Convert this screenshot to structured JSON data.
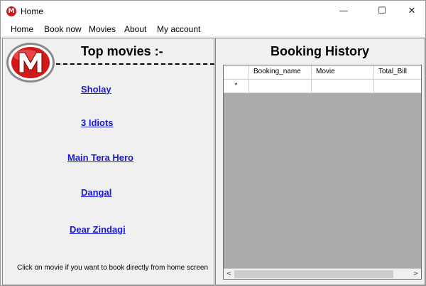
{
  "window": {
    "title": "Home",
    "icon": "app-logo-icon",
    "controls": {
      "minimize": "—",
      "maximize": "☐",
      "close": "✕"
    }
  },
  "menu": {
    "items": [
      "Home",
      "Book now",
      "Movies",
      "About",
      "My account"
    ]
  },
  "left": {
    "logo_letter": "M",
    "title": "Top movies :-",
    "movies": [
      "Sholay",
      "3 Idiots",
      "Main Tera Hero",
      "Dangal",
      "Dear Zindagi"
    ],
    "hint": "Click on movie if you want to book directly from home screen"
  },
  "right": {
    "title": "Booking History",
    "grid": {
      "columns": [
        "Booking_name",
        "Movie",
        "Total_Bill"
      ],
      "new_row_marker": "*",
      "rows": []
    },
    "scrollbar": {
      "left": "<",
      "right": ">"
    }
  },
  "colors": {
    "link": "#1a1ad6",
    "logo_red": "#d11a1a",
    "grid_background": "#ababab",
    "panel": "#f0f0f0"
  }
}
